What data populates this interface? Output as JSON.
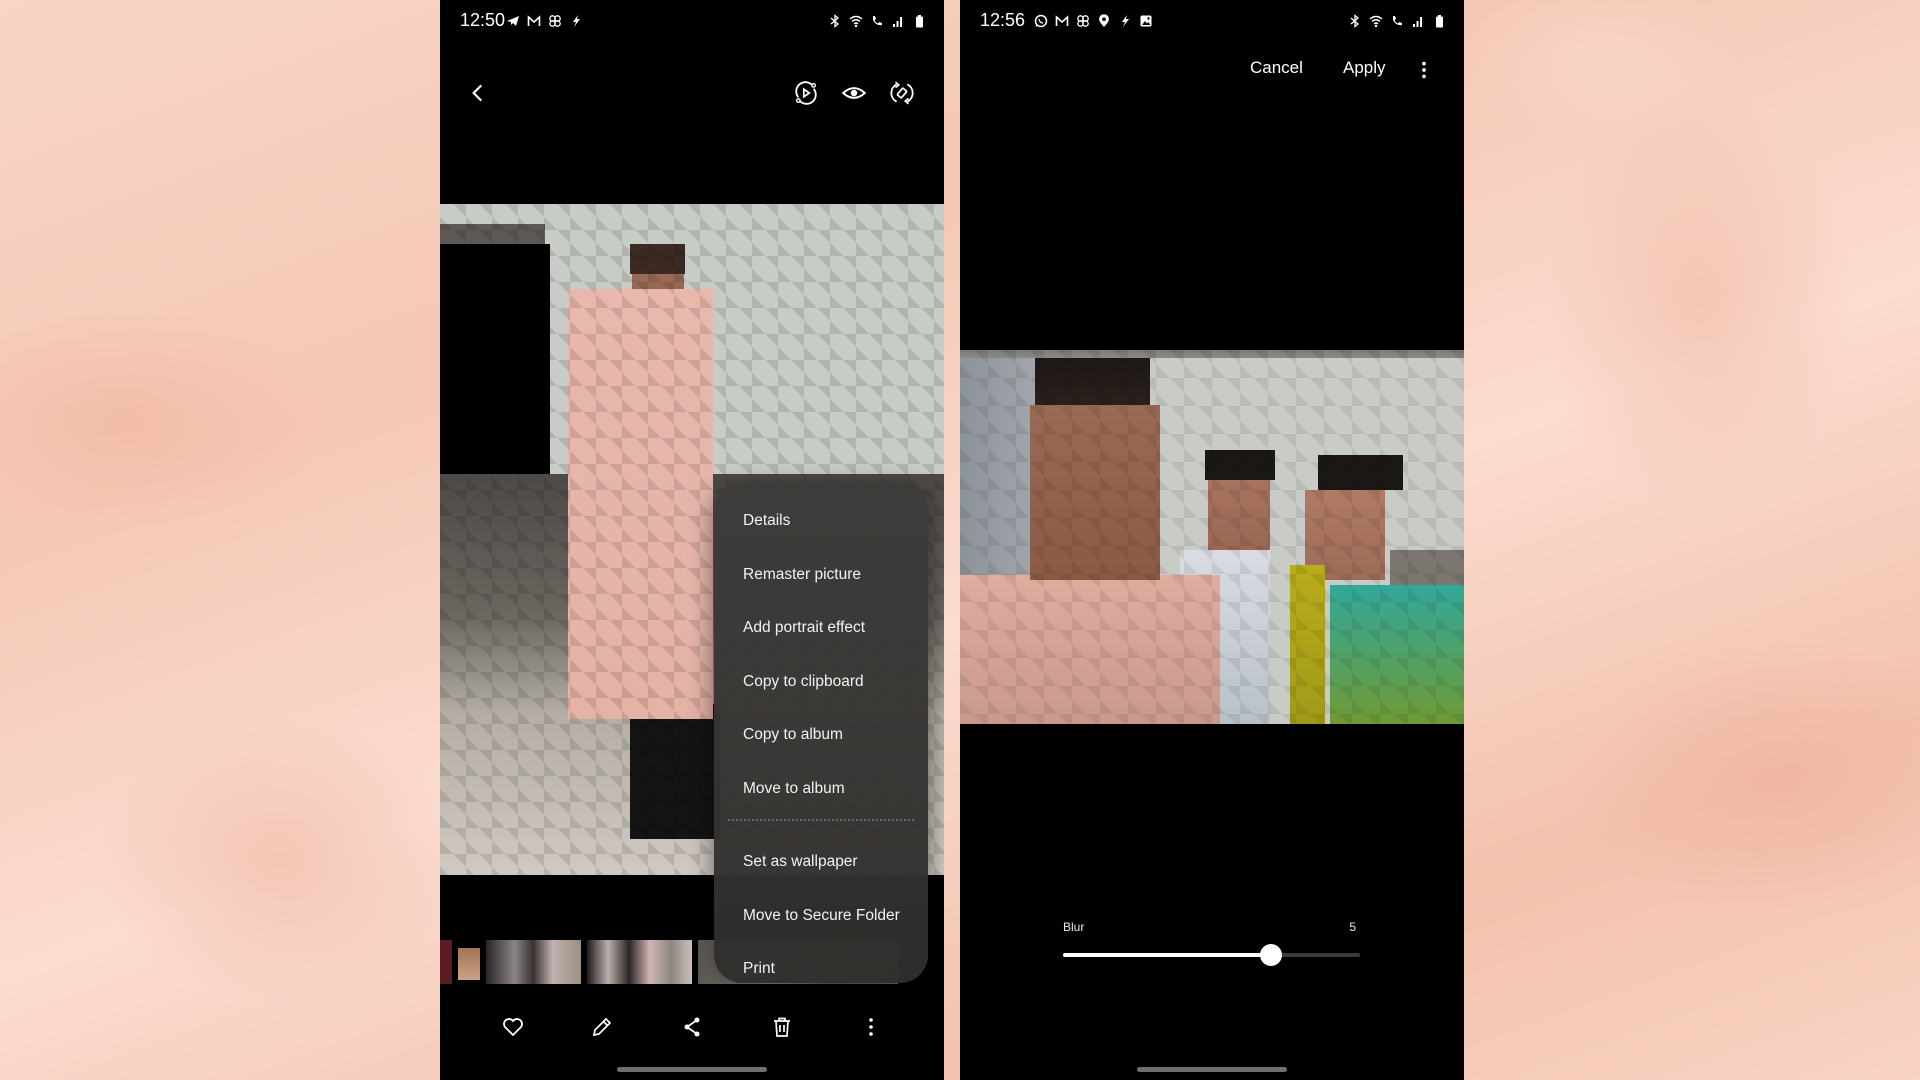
{
  "phone1": {
    "status": {
      "time": "12:50",
      "notification_icons": [
        "telegram-icon",
        "gmail-icon",
        "fan-icon",
        "bolt-icon"
      ],
      "system_icons": [
        "bluetooth-icon",
        "wifi-icon",
        "wifi-calling-icon",
        "signal-icon",
        "battery-icon"
      ]
    },
    "toolbar": {
      "back": "back-icon",
      "actions": [
        "remaster-icon",
        "view-icon",
        "rotate-icon"
      ]
    },
    "menu": {
      "items": [
        "Details",
        "Remaster picture",
        "Add portrait effect",
        "Copy to clipboard",
        "Copy to album",
        "Move to album",
        "Set as wallpaper",
        "Move to Secure Folder",
        "Print"
      ],
      "divider_after_index": 5
    },
    "bottombar": {
      "actions": [
        "favorite",
        "edit",
        "share",
        "delete",
        "more"
      ]
    }
  },
  "phone2": {
    "status": {
      "time": "12:56",
      "notification_icons": [
        "whatsapp-icon",
        "gmail-icon",
        "fan-icon",
        "location-icon",
        "bolt-icon",
        "gallery-icon"
      ],
      "system_icons": [
        "bluetooth-icon",
        "wifi-icon",
        "wifi-calling-icon",
        "signal-icon",
        "battery-icon"
      ]
    },
    "header": {
      "cancel_label": "Cancel",
      "apply_label": "Apply"
    },
    "blur_slider": {
      "label": "Blur",
      "value": "5",
      "fraction": 0.7
    }
  }
}
